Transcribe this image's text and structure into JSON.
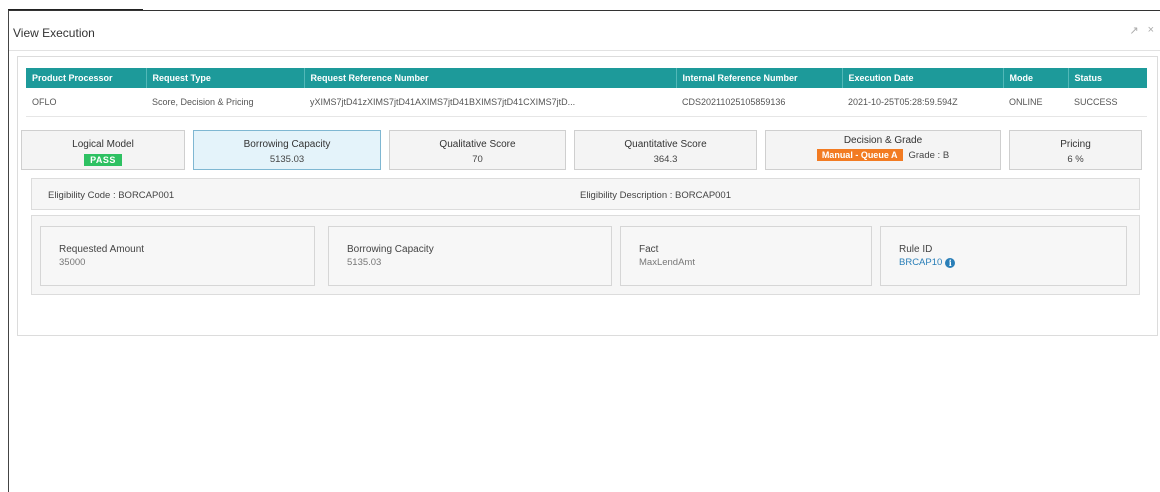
{
  "window": {
    "title": "View Execution",
    "controls": {
      "expand_glyph": "↗",
      "close_glyph": "×"
    }
  },
  "execution_table": {
    "headers": [
      "Product Processor",
      "Request Type",
      "Request Reference Number",
      "Internal Reference Number",
      "Execution Date",
      "Mode",
      "Status"
    ],
    "rows": [
      [
        "OFLO",
        "Score, Decision & Pricing",
        "yXIMS7jtD41zXIMS7jtD41AXIMS7jtD41BXIMS7jtD41CXIMS7jtD...",
        "CDS20211025105859136",
        "2021-10-25T05:28:59.594Z",
        "ONLINE",
        "SUCCESS"
      ]
    ]
  },
  "summary_cards": {
    "logical_model": {
      "label": "Logical Model",
      "badge": "PASS"
    },
    "borrowing_capacity": {
      "label": "Borrowing Capacity",
      "value": "5135.03"
    },
    "qualitative_score": {
      "label": "Qualitative Score",
      "value": "70"
    },
    "quantitative_score": {
      "label": "Quantitative Score",
      "value": "364.3"
    },
    "decision_grade": {
      "label": "Decision & Grade",
      "badge": "Manual - Queue A",
      "grade": "Grade : B"
    },
    "pricing": {
      "label": "Pricing",
      "value": "6 %"
    }
  },
  "eligibility": {
    "code_text": "Eligibility Code : BORCAP001",
    "description_text": "Eligibility Description : BORCAP001"
  },
  "details": {
    "requested_amount": {
      "label": "Requested Amount",
      "value": "35000"
    },
    "borrowing_capacity": {
      "label": "Borrowing Capacity",
      "value": "5135.03"
    },
    "fact": {
      "label": "Fact",
      "value": "MaxLendAmt"
    },
    "rule_id": {
      "label": "Rule ID",
      "value": "BRCAP10",
      "icon": "info-icon"
    }
  },
  "colors": {
    "header_teal": "#1d9a9a",
    "pass_green": "#2ec162",
    "manual_orange": "#f27b22",
    "link_blue": "#2a7fb8",
    "active_card_bg": "#e4f3fa"
  }
}
